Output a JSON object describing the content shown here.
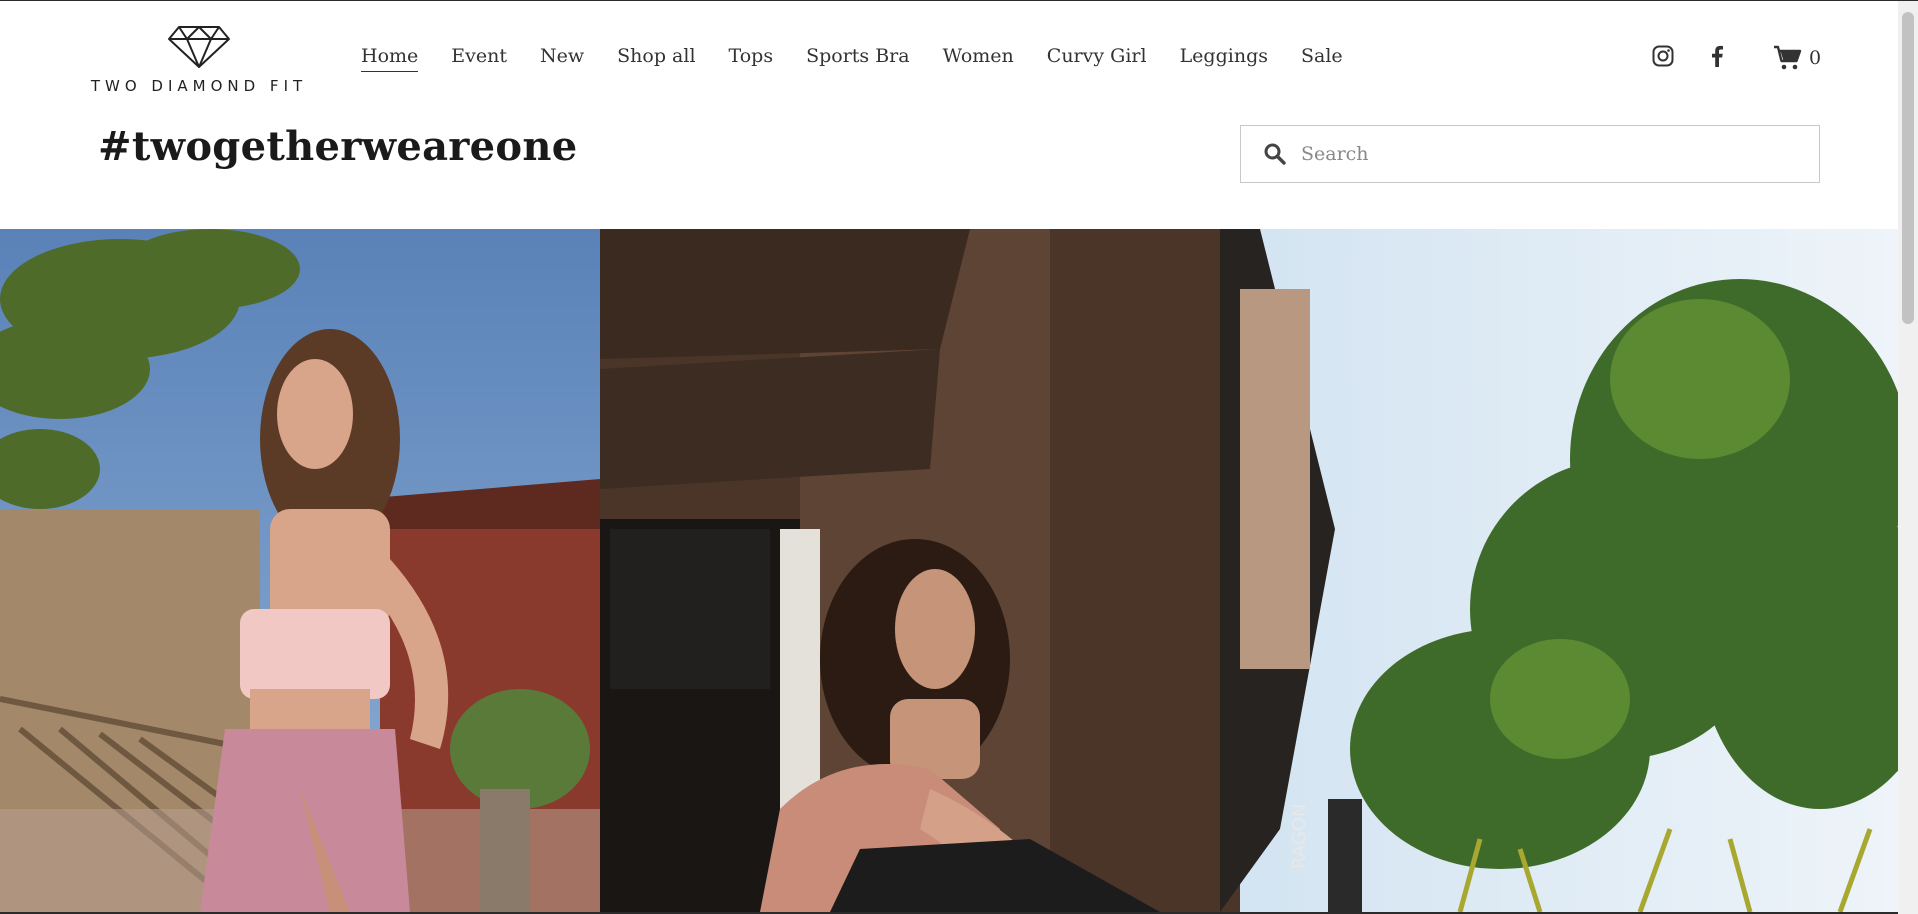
{
  "brand": {
    "name": "TWO DIAMOND FIT",
    "logo_icon": "diamond-icon"
  },
  "nav": {
    "items": [
      {
        "label": "Home",
        "active": true
      },
      {
        "label": "Event"
      },
      {
        "label": "New"
      },
      {
        "label": "Shop all"
      },
      {
        "label": "Tops"
      },
      {
        "label": "Sports Bra"
      },
      {
        "label": "Women"
      },
      {
        "label": "Curvy Girl"
      },
      {
        "label": "Leggings"
      },
      {
        "label": "Sale"
      }
    ]
  },
  "social": {
    "instagram_icon": "instagram-icon",
    "facebook_icon": "facebook-icon"
  },
  "cart": {
    "icon": "cart-icon",
    "count": "0"
  },
  "page": {
    "title": "#twogetherweareone"
  },
  "search": {
    "placeholder": "Search",
    "value": ""
  },
  "hero": {
    "left_image": "woman-in-pink-crop-top-with-palm-tree",
    "right_image": "woman-seated-by-brown-building-and-trees"
  }
}
